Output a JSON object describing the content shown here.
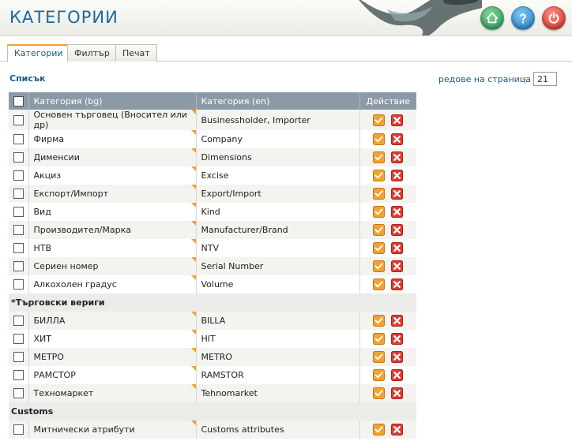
{
  "app": {
    "title": "КАТЕГОРИИ"
  },
  "tabs": [
    {
      "label": "Категории",
      "active": true
    },
    {
      "label": "Филтър",
      "active": false
    },
    {
      "label": "Печат",
      "active": false
    }
  ],
  "list": {
    "title": "Списък",
    "rows_per_page_label": "редове на страница",
    "rows_per_page_arrow": "»",
    "rows_per_page_value": "21"
  },
  "table": {
    "headers": {
      "bg": "Категория (bg)",
      "en": "Категория (en)",
      "action": "Действие"
    },
    "rows": [
      {
        "type": "item",
        "bg": "Основен търговец (Вносител или др)",
        "en": "Businessholder, Importer"
      },
      {
        "type": "item",
        "bg": "Фирма",
        "en": "Company"
      },
      {
        "type": "item",
        "bg": "Дименсии",
        "en": "Dimensions"
      },
      {
        "type": "item",
        "bg": "Акциз",
        "en": "Excise"
      },
      {
        "type": "item",
        "bg": "Експорт/Импорт",
        "en": "Export/Import"
      },
      {
        "type": "item",
        "bg": "Вид",
        "en": "Kind"
      },
      {
        "type": "item",
        "bg": "Производител/Марка",
        "en": "Manufacturer/Brand"
      },
      {
        "type": "item",
        "bg": "НТВ",
        "en": "NTV"
      },
      {
        "type": "item",
        "bg": "Сериен номер",
        "en": "Serial Number"
      },
      {
        "type": "item",
        "bg": "Алкохолен градус",
        "en": "Volume"
      },
      {
        "type": "group",
        "label": "*Търговски вериги"
      },
      {
        "type": "item",
        "bg": "БИЛЛА",
        "en": "BILLA"
      },
      {
        "type": "item",
        "bg": "ХИТ",
        "en": "HIT"
      },
      {
        "type": "item",
        "bg": "МЕТРО",
        "en": "METRO"
      },
      {
        "type": "item",
        "bg": "РАМСТОР",
        "en": "RAMSTOR"
      },
      {
        "type": "item",
        "bg": "Техномаркет",
        "en": "Tehnomarket"
      },
      {
        "type": "group",
        "label": "Customs"
      },
      {
        "type": "item",
        "bg": "Митнически атрибути",
        "en": "Customs attributes"
      }
    ]
  },
  "icons": {
    "home": "home-icon",
    "help": "help-icon",
    "power": "power-icon",
    "edit": "edit-check-icon",
    "delete": "delete-x-icon"
  },
  "colors": {
    "title_blue": "#1b6a9c",
    "header_gray": "#8c9aa7",
    "accent_orange": "#f0a030",
    "delete_red": "#d8322a"
  }
}
